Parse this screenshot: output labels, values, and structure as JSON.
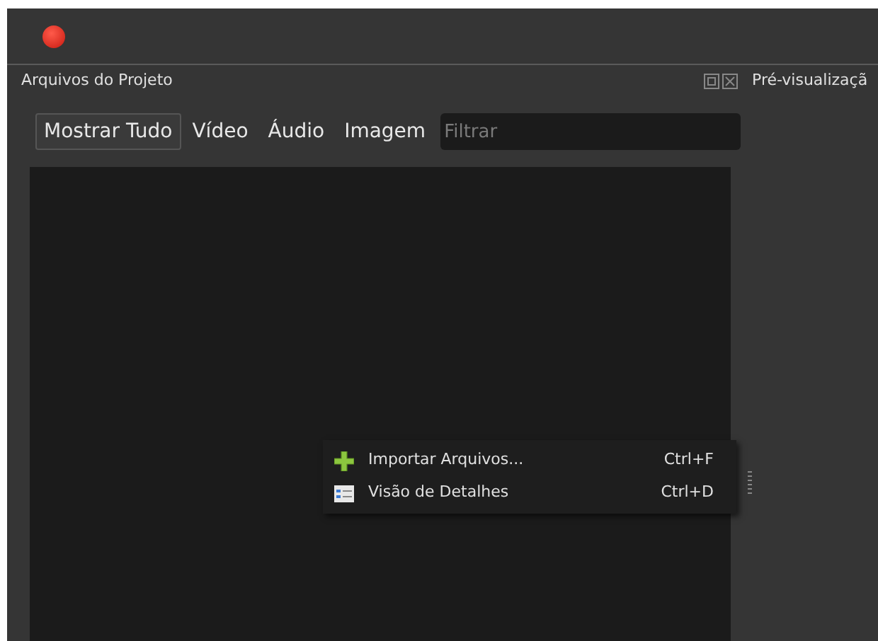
{
  "panel": {
    "title": "Arquivos do Projeto"
  },
  "preview": {
    "title": "Pré-visualizaçã"
  },
  "filters": [
    {
      "label": "Mostrar Tudo",
      "selected": true
    },
    {
      "label": "Vídeo",
      "selected": false
    },
    {
      "label": "Áudio",
      "selected": false
    },
    {
      "label": "Imagem",
      "selected": false
    }
  ],
  "search": {
    "placeholder": "Filtrar"
  },
  "context_menu": [
    {
      "kind": "import",
      "label": "Importar Arquivos...",
      "shortcut": "Ctrl+F"
    },
    {
      "kind": "details",
      "label": "Visão de Detalhes",
      "shortcut": "Ctrl+D"
    }
  ]
}
